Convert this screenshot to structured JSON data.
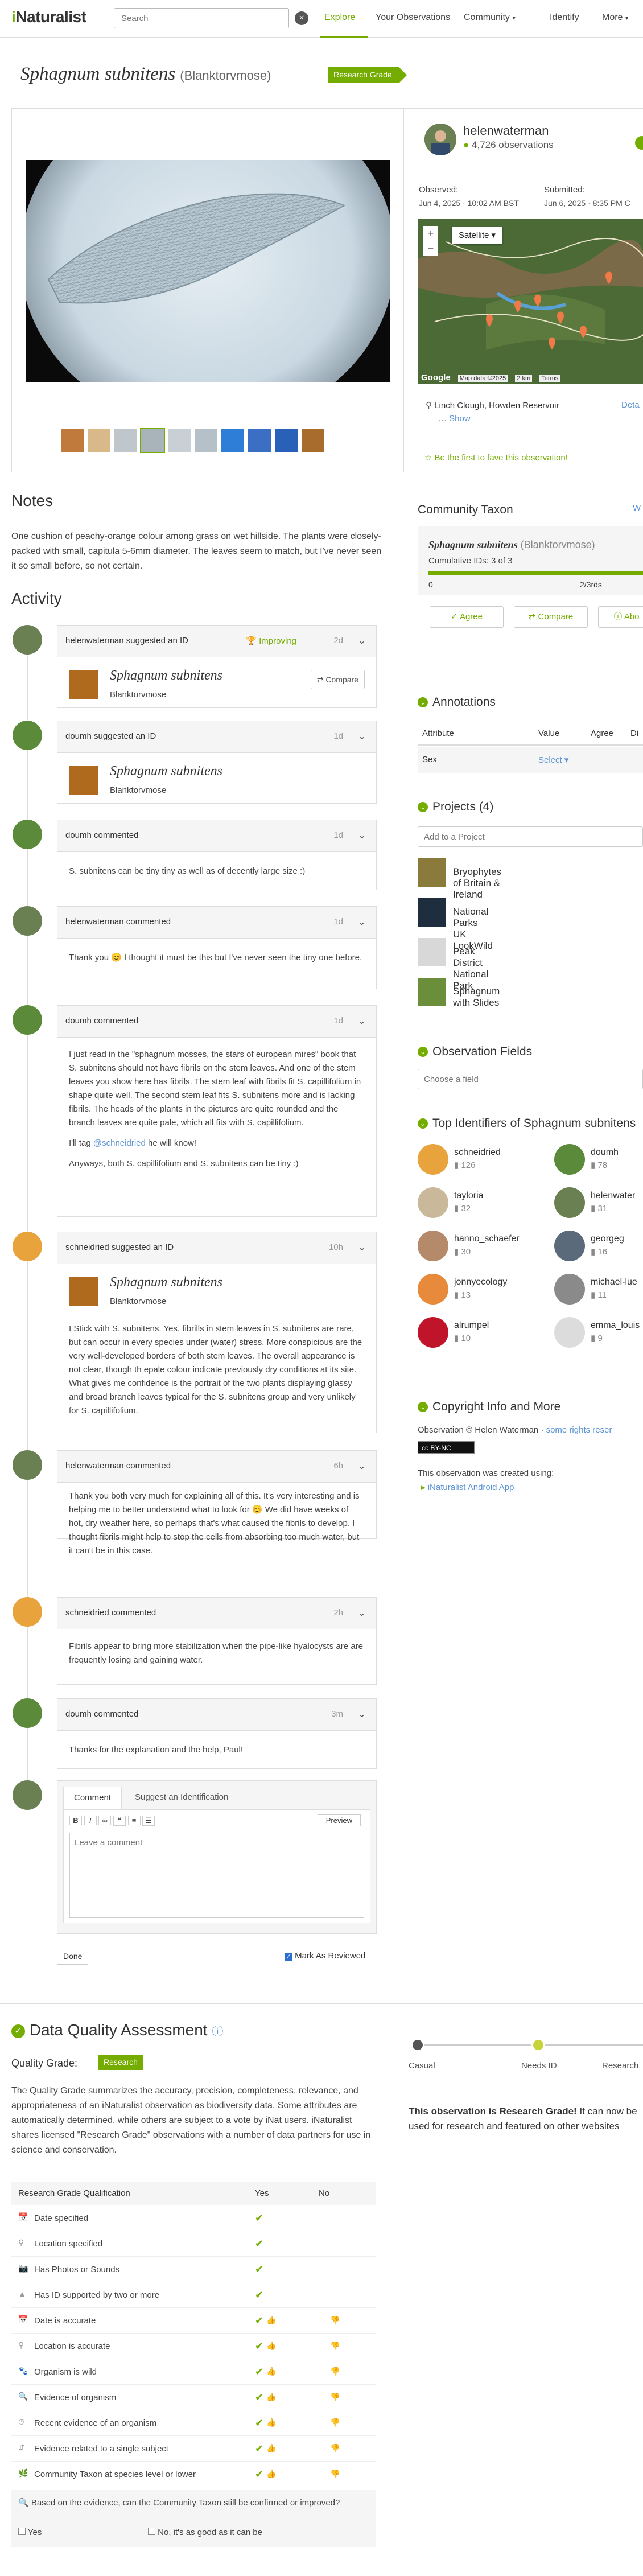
{
  "header": {
    "logo": "iNaturalist",
    "search_placeholder": "Search",
    "nav": [
      "Explore",
      "Your Observations",
      "Community",
      "Identify",
      "More"
    ]
  },
  "observation": {
    "taxon_name": "Sphagnum subnitens",
    "common_name": "(Blanktorvmose)",
    "grade_badge": "Research Grade",
    "user": "helenwaterman",
    "user_obs": "4,726 observations",
    "observed_label": "Observed:",
    "observed_date": "Jun 4, 2025 · 10:02 AM BST",
    "submitted_label": "Submitted:",
    "submitted_date": "Jun 6, 2025 · 8:35 PM C",
    "map_type": "Satellite",
    "place": "Linch Clough, Howden Reservoir",
    "place_details": "Deta",
    "show_link": "Show",
    "map_credit": "Google",
    "map_data": "Map data ©2025",
    "map_scale": "2 km",
    "map_terms": "Terms",
    "fave": "Be the first to fave this observation!"
  },
  "notes": {
    "title": "Notes",
    "text": "One cushion of peachy-orange colour among grass on wet hillside. The plants were closely-packed with small, capitula 5-6mm diameter. The leaves seem to match, but I've never seen it so small before, so not certain."
  },
  "activity": {
    "title": "Activity",
    "items": [
      {
        "who": "helenwaterman suggested an ID",
        "status": "Improving",
        "ago": "2d",
        "taxon": "Sphagnum subnitens",
        "common": "Blanktorvmose",
        "compare": "Compare"
      },
      {
        "who": "doumh suggested an ID",
        "ago": "1d",
        "taxon": "Sphagnum subnitens",
        "common": "Blanktorvmose"
      },
      {
        "who": "doumh commented",
        "ago": "1d",
        "text": "S. subnitens can be tiny tiny as well as of decently large size :)"
      },
      {
        "who": "helenwaterman commented",
        "ago": "1d",
        "text": "Thank you 😊 I thought it must be this but I've never seen the tiny one before."
      },
      {
        "who": "doumh commented",
        "ago": "1d",
        "p1": "I just read in the \"sphagnum mosses, the stars of european mires\" book that S. subnitens should not have fibrils on the stem leaves. And one of the stem leaves you show here has fibrils. The stem leaf with fibrils fit S. capillifolium in shape quite well. The second stem leaf fits S. subnitens more and is lacking fibrils. The heads of the plants in the pictures are quite rounded and the branch leaves are quite pale, which all fits with S. capillifolium.",
        "p2a": "I'll tag ",
        "mention": "@schneidried",
        "p2b": " he will know!",
        "p3": "Anyways, both S. capillifolium and S. subnitens can be tiny :)"
      },
      {
        "who": "schneidried suggested an ID",
        "ago": "10h",
        "taxon": "Sphagnum subnitens",
        "common": "Blanktorvmose",
        "text": "I Stick with S. subnitens. Yes. fibrills in stem leaves in S. subnitens are rare, but can occur in every species under (water) stress. More conspicious are the very well-developed borders of both stem leaves. The overall appearance is not clear, though th epale colour indicate previously dry conditions at its site. What gives me confidence is the portrait of the two plants displaying glassy and broad branch leaves typical for the S. subnitens group and very unlikely for S. capillifolium."
      },
      {
        "who": "helenwaterman commented",
        "ago": "6h",
        "text": "Thank you both very much for explaining all of this. It's very interesting and is helping me to better understand what to look for 😊 We did have weeks of hot, dry weather here, so perhaps that's what caused the fibrils to develop. I thought fibrils might help to stop the cells from absorbing too much water, but it can't be in this case."
      },
      {
        "who": "schneidried commented",
        "ago": "2h",
        "text": "Fibrils appear to bring more stabilization when the pipe-like hyalocysts are are frequently losing and gaining water."
      },
      {
        "who": "doumh commented",
        "ago": "3m",
        "text": "Thanks for the explanation and the help, Paul!"
      }
    ]
  },
  "comment_form": {
    "tab_comment": "Comment",
    "tab_suggest": "Suggest an Identification",
    "preview": "Preview",
    "placeholder": "Leave a comment",
    "done": "Done",
    "mark_reviewed": "Mark As Reviewed"
  },
  "community_taxon": {
    "title": "Community Taxon",
    "what": "W",
    "taxon": "Sphagnum subnitens",
    "common": "(Blanktorvmose)",
    "cumulative": "Cumulative IDs: 3 of 3",
    "scale_min": "0",
    "scale_mid": "2/3rds",
    "progress": 1.0,
    "agree": "Agree",
    "compare": "Compare",
    "about": "Abo"
  },
  "annotations": {
    "title": "Annotations",
    "cols": [
      "Attribute",
      "Value",
      "Agree",
      "Di"
    ],
    "row_attr": "Sex",
    "row_value": "Select"
  },
  "projects": {
    "title": "Projects (4)",
    "add_placeholder": "Add to a Project",
    "items": [
      "Bryophytes of Britain & Ireland",
      "National Parks UK LookWild",
      "Peak District National Park",
      "Sphagnum with Slides"
    ]
  },
  "obs_fields": {
    "title": "Observation Fields",
    "placeholder": "Choose a field"
  },
  "identifiers": {
    "title": "Top Identifiers of Sphagnum subnitens",
    "people": [
      {
        "name": "schneidried",
        "count": "126"
      },
      {
        "name": "doumh",
        "count": "78"
      },
      {
        "name": "tayloria",
        "count": "32"
      },
      {
        "name": "helenwater",
        "count": "31"
      },
      {
        "name": "hanno_schaefer",
        "count": "30"
      },
      {
        "name": "georgeg",
        "count": "16"
      },
      {
        "name": "jonnyecology",
        "count": "13"
      },
      {
        "name": "michael-lue",
        "count": "11"
      },
      {
        "name": "alrumpel",
        "count": "10"
      },
      {
        "name": "emma_louis",
        "count": "9"
      }
    ]
  },
  "copyright": {
    "title": "Copyright Info and More",
    "line": "Observation © Helen Waterman · ",
    "link": "some rights reser",
    "cc": "cc BY-NC",
    "created": "This observation was created using:",
    "app": "iNaturalist Android App"
  },
  "dqa": {
    "title": "Data Quality Assessment",
    "grade_label": "Quality Grade:",
    "grade": "Research",
    "desc": "The Quality Grade summarizes the accuracy, precision, completeness, relevance, and appropriateness of an iNaturalist observation as biodiversity data. Some attributes are automatically determined, while others are subject to a vote by iNat users. iNaturalist shares licensed \"Research Grade\" observations with a number of data partners for use in science and conservation.",
    "stages": [
      "Casual",
      "Needs ID",
      "Research"
    ],
    "rg_msg_bold": "This observation is Research Grade!",
    "rg_msg": " It can now be used for research and featured on other websites",
    "table_head": [
      "Research Grade Qualification",
      "Yes",
      "No"
    ],
    "rows": [
      "Date specified",
      "Location specified",
      "Has Photos or Sounds",
      "Has ID supported by two or more",
      "Date is accurate",
      "Location is accurate",
      "Organism is wild",
      "Evidence of organism",
      "Recent evidence of an organism",
      "Evidence related to a single subject",
      "Community Taxon at species level or lower"
    ],
    "question": "Based on the evidence, can the Community Taxon still be confirmed or improved?",
    "answer_yes": "Yes",
    "answer_no": "No, it's as good as it can be"
  }
}
